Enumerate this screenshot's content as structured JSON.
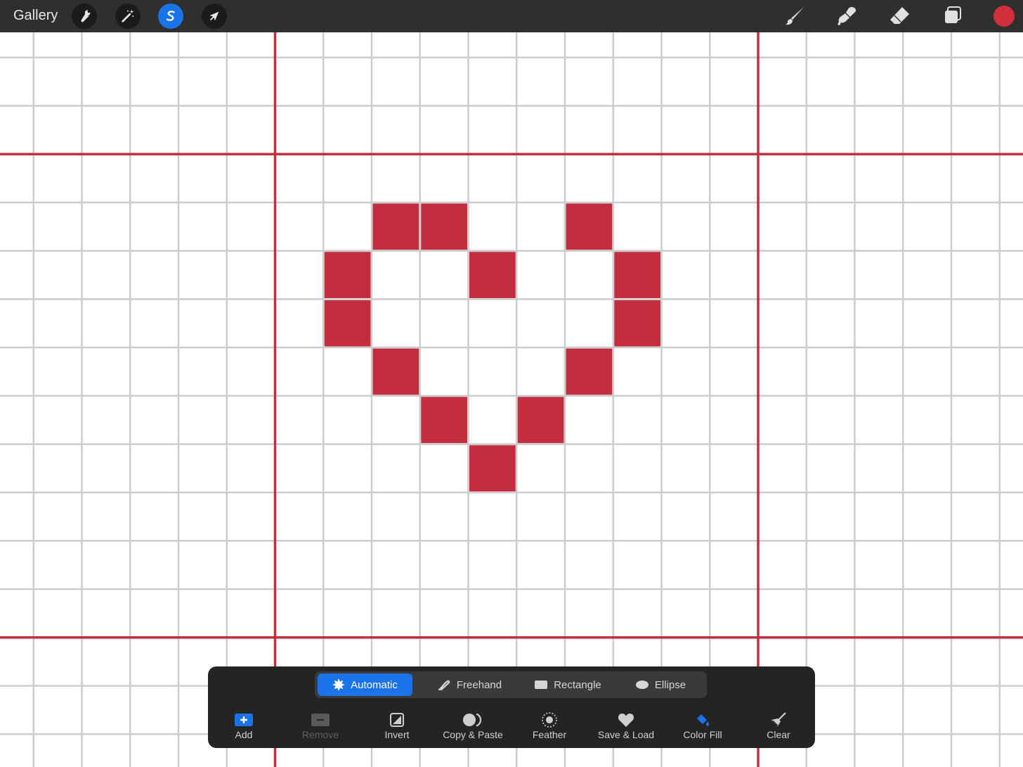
{
  "topbar": {
    "gallery_label": "Gallery",
    "left_tools": [
      "wrench-icon",
      "magic-wand-icon",
      "selection-s-icon",
      "arrow-transform-icon"
    ],
    "active_tool": "selection-s-icon",
    "right_tools": [
      "brush-icon",
      "smudge-icon",
      "eraser-icon",
      "layers-icon"
    ],
    "current_color": "#d32f3a"
  },
  "canvas": {
    "background": "#ffffff",
    "grid_line_color": "#cccccc",
    "guide_line_color": "#c0303f",
    "pixel_color": "#c22e40",
    "heart_pixels": [
      [
        8,
        4
      ],
      [
        9,
        4
      ],
      [
        12,
        4
      ],
      [
        7,
        5
      ],
      [
        10,
        5
      ],
      [
        13,
        5
      ],
      [
        7,
        6
      ],
      [
        13,
        6
      ],
      [
        8,
        7
      ],
      [
        12,
        7
      ],
      [
        9,
        8
      ],
      [
        11,
        8
      ],
      [
        10,
        9
      ]
    ]
  },
  "selection_panel": {
    "modes": [
      {
        "label": "Automatic",
        "icon": "automatic-starburst-icon",
        "active": true
      },
      {
        "label": "Freehand",
        "icon": "freehand-lasso-icon",
        "active": false
      },
      {
        "label": "Rectangle",
        "icon": "rectangle-icon",
        "active": false
      },
      {
        "label": "Ellipse",
        "icon": "ellipse-icon",
        "active": false
      }
    ],
    "tools": [
      {
        "label": "Add",
        "icon": "add-icon",
        "enabled": true
      },
      {
        "label": "Remove",
        "icon": "remove-icon",
        "enabled": false
      },
      {
        "label": "Invert",
        "icon": "invert-icon",
        "enabled": true
      },
      {
        "label": "Copy & Paste",
        "icon": "copy-paste-icon",
        "enabled": true
      },
      {
        "label": "Feather",
        "icon": "feather-icon",
        "enabled": true
      },
      {
        "label": "Save & Load",
        "icon": "heart-icon",
        "enabled": true
      },
      {
        "label": "Color Fill",
        "icon": "color-fill-icon",
        "enabled": true
      },
      {
        "label": "Clear",
        "icon": "broom-icon",
        "enabled": true
      }
    ]
  }
}
